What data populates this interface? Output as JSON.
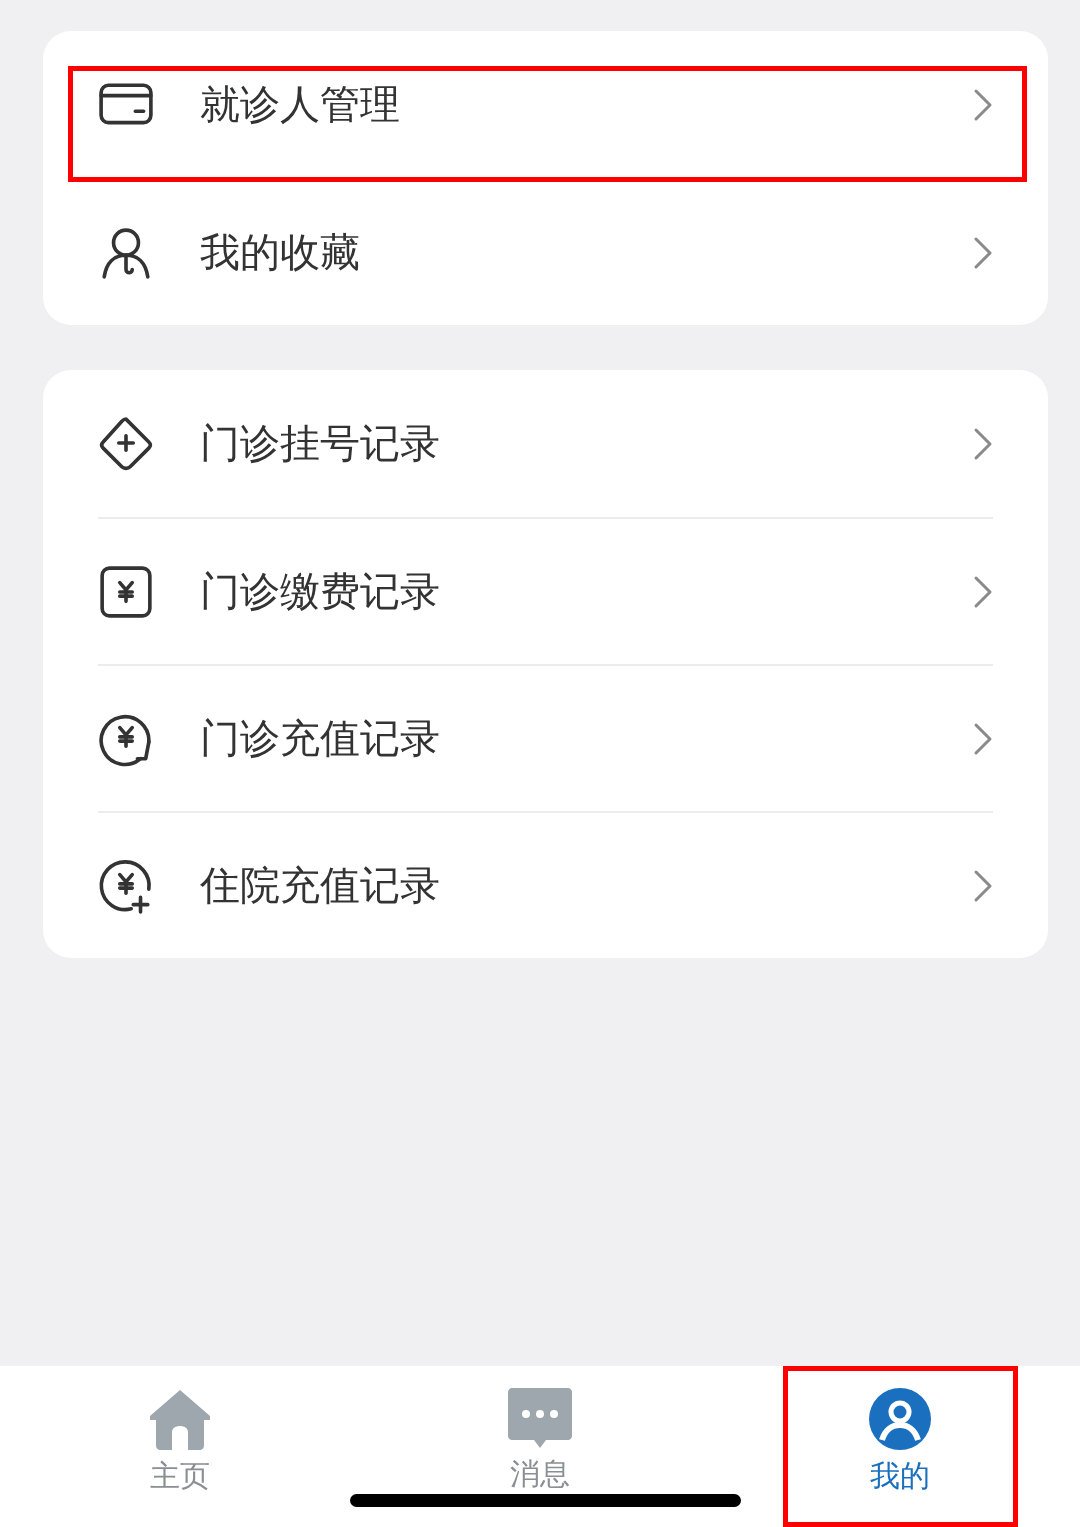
{
  "groups": [
    {
      "items": [
        {
          "kind": "card",
          "label": "就诊人管理",
          "highlighted": true
        },
        {
          "kind": "person",
          "label": "我的收藏",
          "highlighted": false
        }
      ]
    },
    {
      "items": [
        {
          "kind": "plus-diamond",
          "label": "门诊挂号记录",
          "highlighted": false
        },
        {
          "kind": "yen-square",
          "label": "门诊缴费记录",
          "highlighted": false
        },
        {
          "kind": "yen-cycle",
          "label": "门诊充值记录",
          "highlighted": false
        },
        {
          "kind": "yen-plus",
          "label": "住院充值记录",
          "highlighted": false
        }
      ]
    }
  ],
  "tab_bar": [
    {
      "kind": "home",
      "label": "主页",
      "selected": false,
      "highlighted": false
    },
    {
      "kind": "chat",
      "label": "消息",
      "selected": false,
      "highlighted": false
    },
    {
      "kind": "user",
      "label": "我的",
      "selected": true,
      "highlighted": true
    }
  ]
}
